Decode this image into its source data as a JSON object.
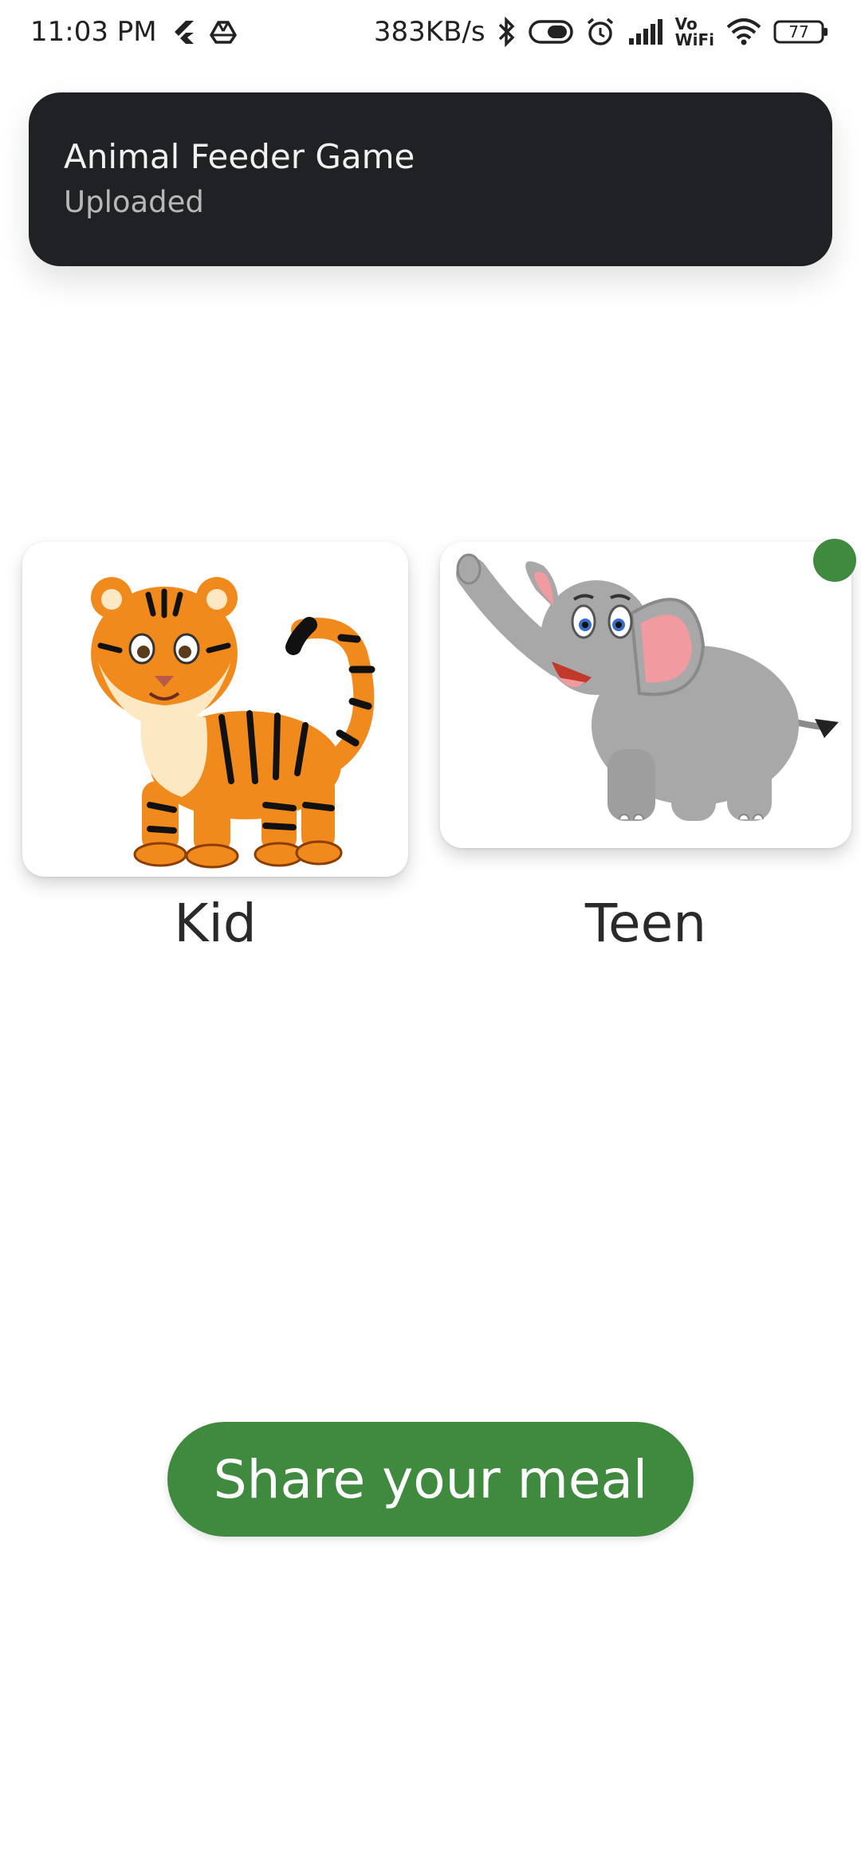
{
  "status_bar": {
    "time": "11:03 PM",
    "net_speed": "383KB/s",
    "battery": "77",
    "icons": [
      "flutter-icon",
      "drive-icon",
      "bluetooth-icon",
      "toggle-icon",
      "alarm-icon",
      "signal-icon",
      "vowifi-icon",
      "wifi-icon",
      "battery-icon"
    ],
    "vowifi_top": "Vo",
    "vowifi_bottom": "WiFi"
  },
  "notification": {
    "title": "Animal Feeder Game",
    "subtitle": "Uploaded"
  },
  "options": [
    {
      "label": "Kid",
      "image": "tiger-illustration",
      "selected": false
    },
    {
      "label": "Teen",
      "image": "elephant-illustration",
      "selected": true
    }
  ],
  "share_button": {
    "label": "Share your meal"
  },
  "colors": {
    "accent": "#3f8a3f",
    "banner_bg": "#202124",
    "tiger_orange": "#f08a1c",
    "elephant_gray": "#a8a8a8",
    "ear_pink": "#f19aa0"
  }
}
